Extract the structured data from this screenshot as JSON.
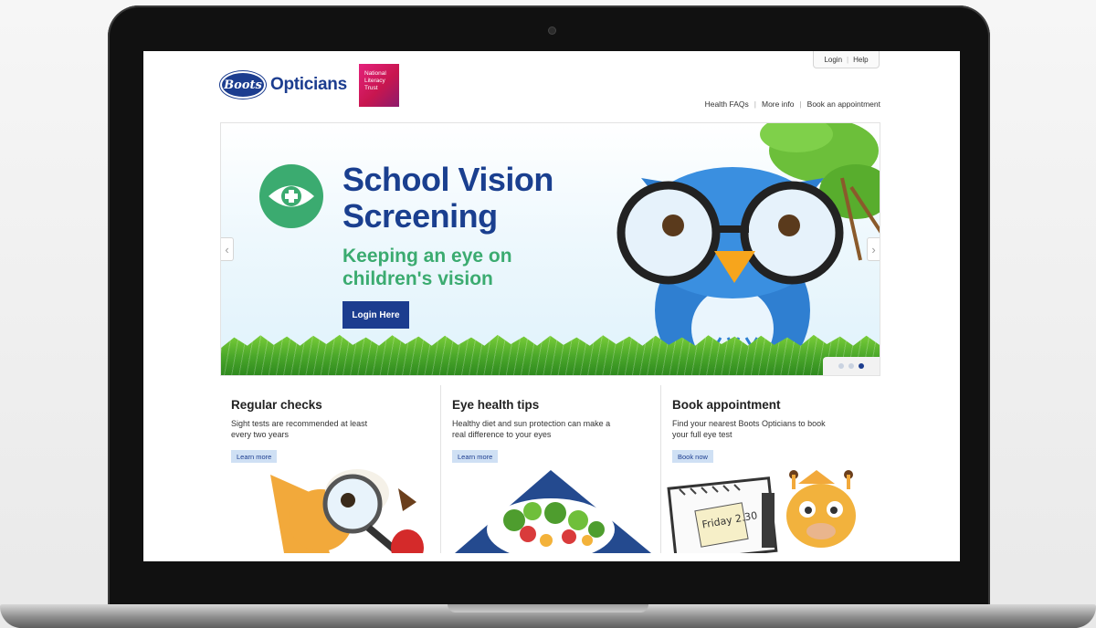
{
  "header": {
    "brand_logo": "Boots",
    "brand_name": "Opticians",
    "partner_badge": "National Literacy Trust",
    "top_links": [
      "Login",
      "Help"
    ],
    "nav_links": [
      "Health FAQs",
      "More info",
      "Book an appointment"
    ]
  },
  "hero": {
    "title": "School Vision Screening",
    "subtitle": "Keeping an eye on children's vision",
    "cta_label": "Login Here",
    "prev_icon": "chevron-left-icon",
    "next_icon": "chevron-right-icon",
    "slides": {
      "count": 3,
      "active": 3
    }
  },
  "promos": [
    {
      "title": "Regular checks",
      "text": "Sight tests are recommended at least every two years",
      "button": "Learn more"
    },
    {
      "title": "Eye health tips",
      "text": "Healthy diet and sun protection can make a real difference to your eyes",
      "button": "Learn more"
    },
    {
      "title": "Book appointment",
      "text": "Find your nearest Boots Opticians to book your full eye test",
      "button": "Book now",
      "note_text": "Friday 2.30"
    }
  ],
  "colors": {
    "brand_blue": "#1c3d8f",
    "accent_green": "#3bab70",
    "button_light": "#cfe0f4"
  }
}
